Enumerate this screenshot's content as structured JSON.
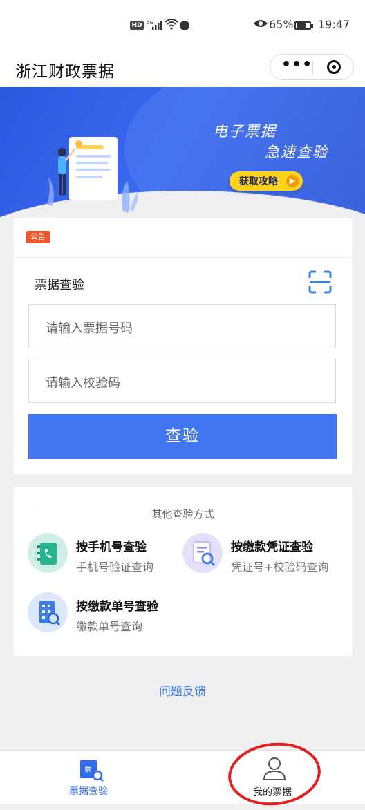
{
  "status_bar": {
    "hd": "HD",
    "network": "5G",
    "battery_pct": "65%",
    "time": "19:47"
  },
  "title_bar": {
    "title": "浙江财政票据",
    "more_glyph": "•••"
  },
  "banner": {
    "slogan_line1": "电子票据",
    "slogan_line2": "急速查验",
    "guide_button": "获取攻略"
  },
  "notice": {
    "tag": "公告"
  },
  "verify": {
    "title": "票据查验",
    "invoice_number_placeholder": "请输入票据号码",
    "check_code_placeholder": "请输入校验码",
    "submit_label": "查验"
  },
  "other_methods": {
    "heading": "其他查验方式",
    "items": [
      {
        "title": "按手机号查验",
        "subtitle": "手机号验证查询"
      },
      {
        "title": "按缴款凭证查验",
        "subtitle": "凭证号+校验码查询"
      },
      {
        "title": "按缴款单号查验",
        "subtitle": "缴款单号查询"
      }
    ]
  },
  "feedback_link": "问题反馈",
  "tab_bar": {
    "tabs": [
      {
        "label": "票据查验",
        "active": true
      },
      {
        "label": "我的票据",
        "active": false
      }
    ]
  },
  "colors": {
    "primary_blue": "#4275f0",
    "banner_blue": "#2c58e0",
    "notice_orange": "#f0552a",
    "guide_yellow": "#ffd21e",
    "annotation_red": "#e52020"
  }
}
